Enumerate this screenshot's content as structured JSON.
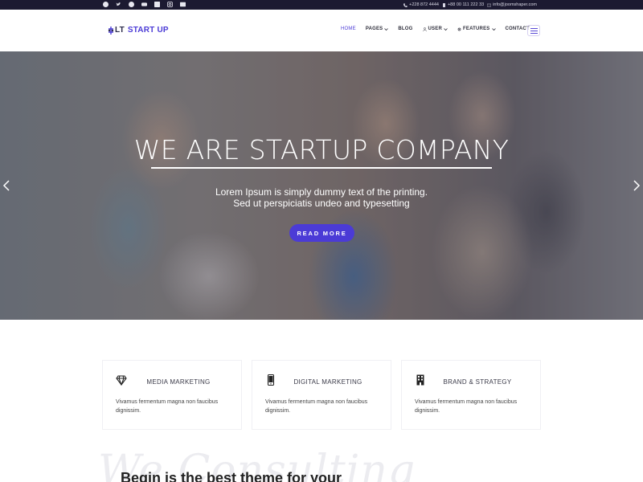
{
  "topbar": {
    "social": [
      "facebook-icon",
      "twitter-icon",
      "pinterest-icon",
      "youtube-icon",
      "linkedin-icon",
      "instagram-icon",
      "flickr-icon"
    ],
    "phone1": "+228 872 4444",
    "phone2": "+88 00 111 222 33",
    "email": "info@joomshaper.com"
  },
  "header": {
    "logo_lt": "LT",
    "logo_name": "START UP",
    "nav": {
      "home": "HOME",
      "pages": "PAGES",
      "blog": "BLOG",
      "user": "USER",
      "features": "FEATURES",
      "contact": "CONTACT"
    }
  },
  "hero": {
    "title": "WE ARE STARTUP COMPANY",
    "subtitle_line1": "Lorem Ipsum is simply dummy text of the printing.",
    "subtitle_line2": "Sed ut perspiciatis undeo and typesetting",
    "button": "READ MORE"
  },
  "features": [
    {
      "icon": "diamond-icon",
      "title": "MEDIA MARKETING",
      "desc": "Vivamus fermentum magna non faucibus dignissim."
    },
    {
      "icon": "mobile-icon",
      "title": "DIGITAL MARKETING",
      "desc": "Vivamus fermentum magna non faucibus dignissim."
    },
    {
      "icon": "building-icon",
      "title": "BRAND & STRATEGY",
      "desc": "Vivamus fermentum magna non faucibus dignissim."
    }
  ],
  "about": {
    "script_text": "We Consulting",
    "title": "Begin is the best theme for your"
  },
  "colors": {
    "accent": "#4b3bd6",
    "topbar": "#1c1a31"
  }
}
